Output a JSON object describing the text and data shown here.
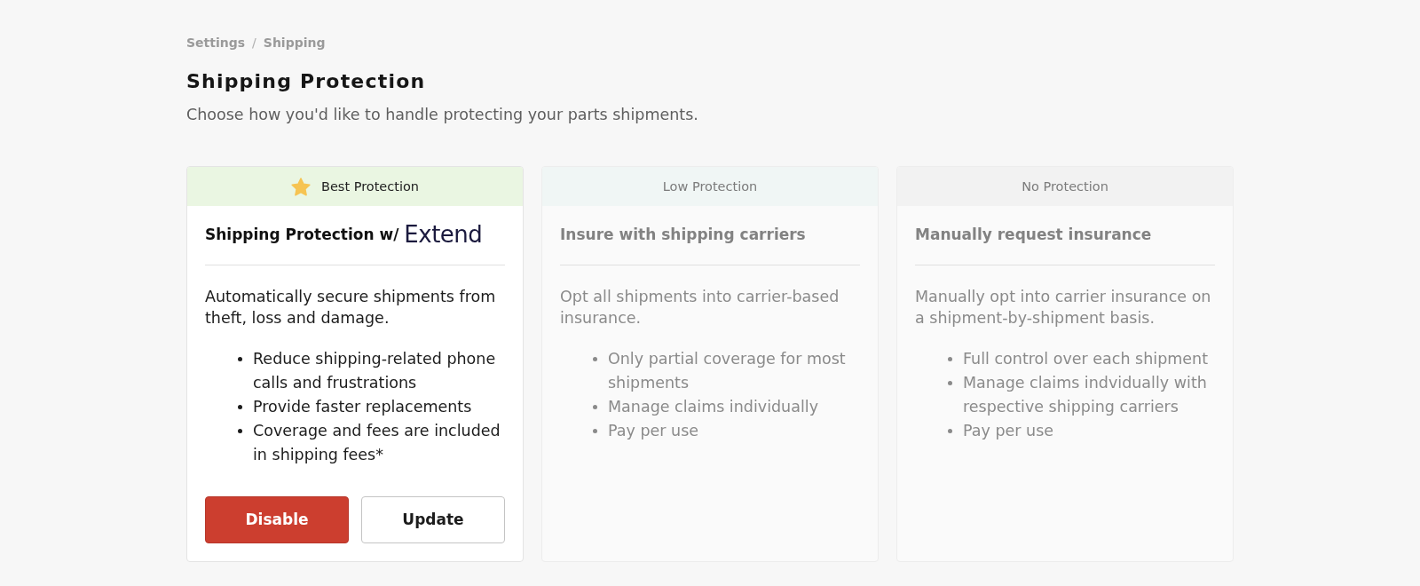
{
  "breadcrumb": {
    "items": [
      "Settings",
      "Shipping"
    ],
    "separator": "/"
  },
  "page": {
    "title": "Shipping Protection",
    "subtitle": "Choose how you'd like to handle protecting your parts shipments."
  },
  "options": [
    {
      "tier": "Best Protection",
      "color": "#eaf6e2",
      "selected": true,
      "title": "Shipping Protection w/",
      "logo": "Extend",
      "description": "Automatically secure shipments from theft, loss and damage.",
      "bullets": [
        "Reduce shipping-related phone calls and frustrations",
        "Provide faster replacements",
        "Coverage and fees are included in shipping fees*"
      ],
      "buttons": [
        {
          "label": "Disable",
          "kind": "danger"
        },
        {
          "label": "Update",
          "kind": "secondary"
        }
      ]
    },
    {
      "tier": "Low Protection",
      "color": "#f0f6f5",
      "selected": false,
      "title": "Insure with shipping carriers",
      "description": "Opt all shipments into carrier-based insurance.",
      "bullets": [
        "Only partial coverage for most shipments",
        "Manage claims individually",
        "Pay per use"
      ]
    },
    {
      "tier": "No Protection",
      "color": "#f2f2f2",
      "selected": false,
      "title": "Manually request insurance",
      "description": "Manually opt into carrier insurance on a shipment-by-shipment basis.",
      "bullets": [
        "Full control over each shipment",
        "Manage claims indvidually with respective shipping carriers",
        "Pay per use"
      ]
    }
  ]
}
